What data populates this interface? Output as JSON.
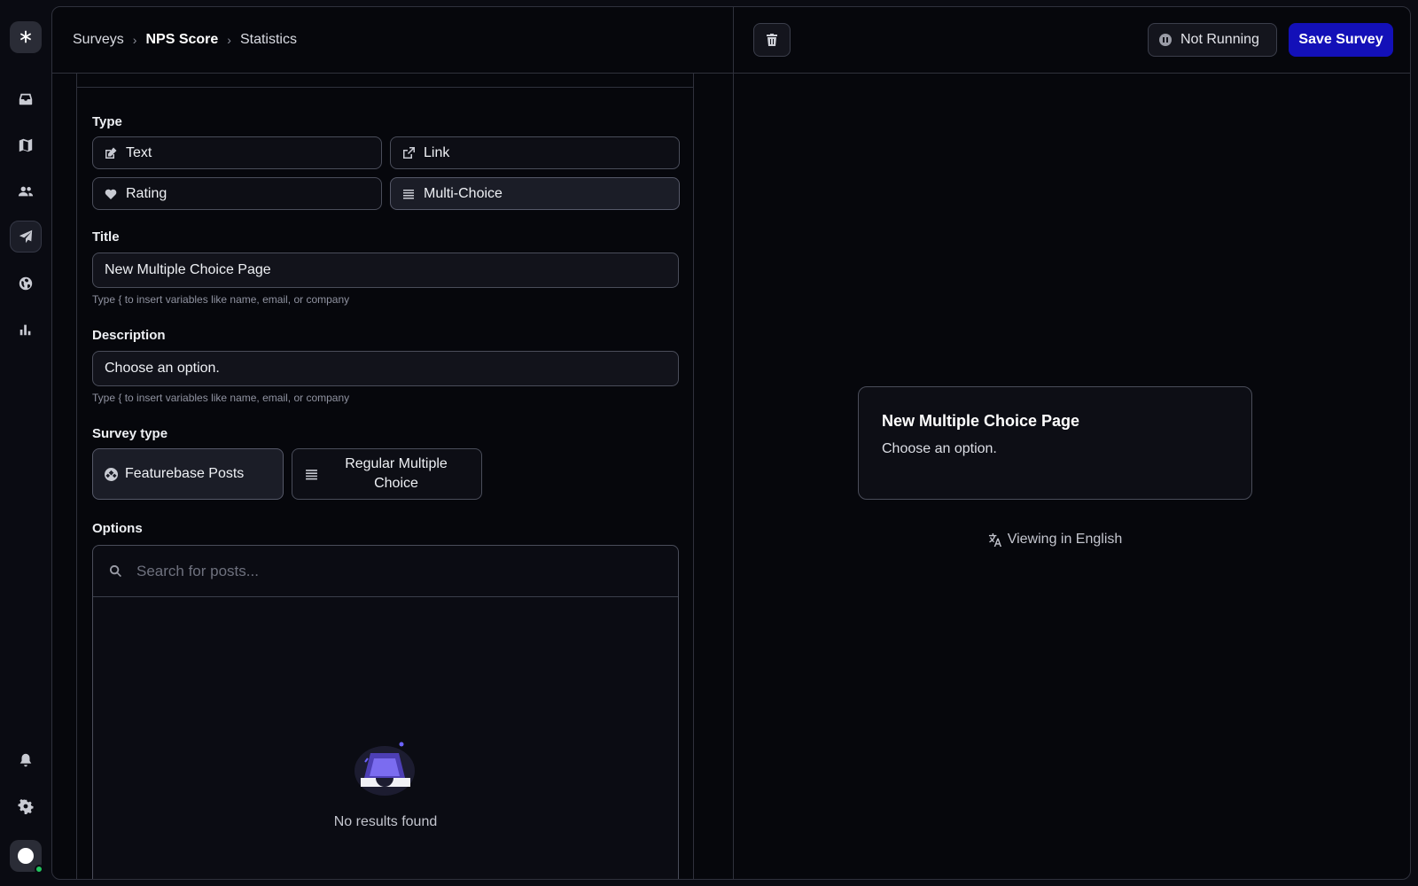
{
  "breadcrumb": {
    "items": [
      "Surveys",
      "NPS Score",
      "Statistics"
    ]
  },
  "header": {
    "status_label": "Not Running",
    "save_label": "Save Survey"
  },
  "editor": {
    "type_label": "Type",
    "type_options": [
      "Text",
      "Link",
      "Rating",
      "Multi-Choice"
    ],
    "type_selected": "Multi-Choice",
    "title_label": "Title",
    "title_value": "New Multiple Choice Page",
    "title_hint": "Type { to insert variables like name, email, or company",
    "description_label": "Description",
    "description_value": "Choose an option.",
    "description_hint": "Type { to insert variables like name, email, or company",
    "survey_type_label": "Survey type",
    "survey_type_options": [
      "Featurebase Posts",
      "Regular Multiple Choice"
    ],
    "survey_type_selected": "Featurebase Posts",
    "options_label": "Options",
    "search_placeholder": "Search for posts...",
    "empty_text": "No results found"
  },
  "preview": {
    "title": "New Multiple Choice Page",
    "description": "Choose an option.",
    "language_text": "Viewing in English"
  },
  "colors": {
    "accent": "#1310b8",
    "background": "#06070c"
  }
}
